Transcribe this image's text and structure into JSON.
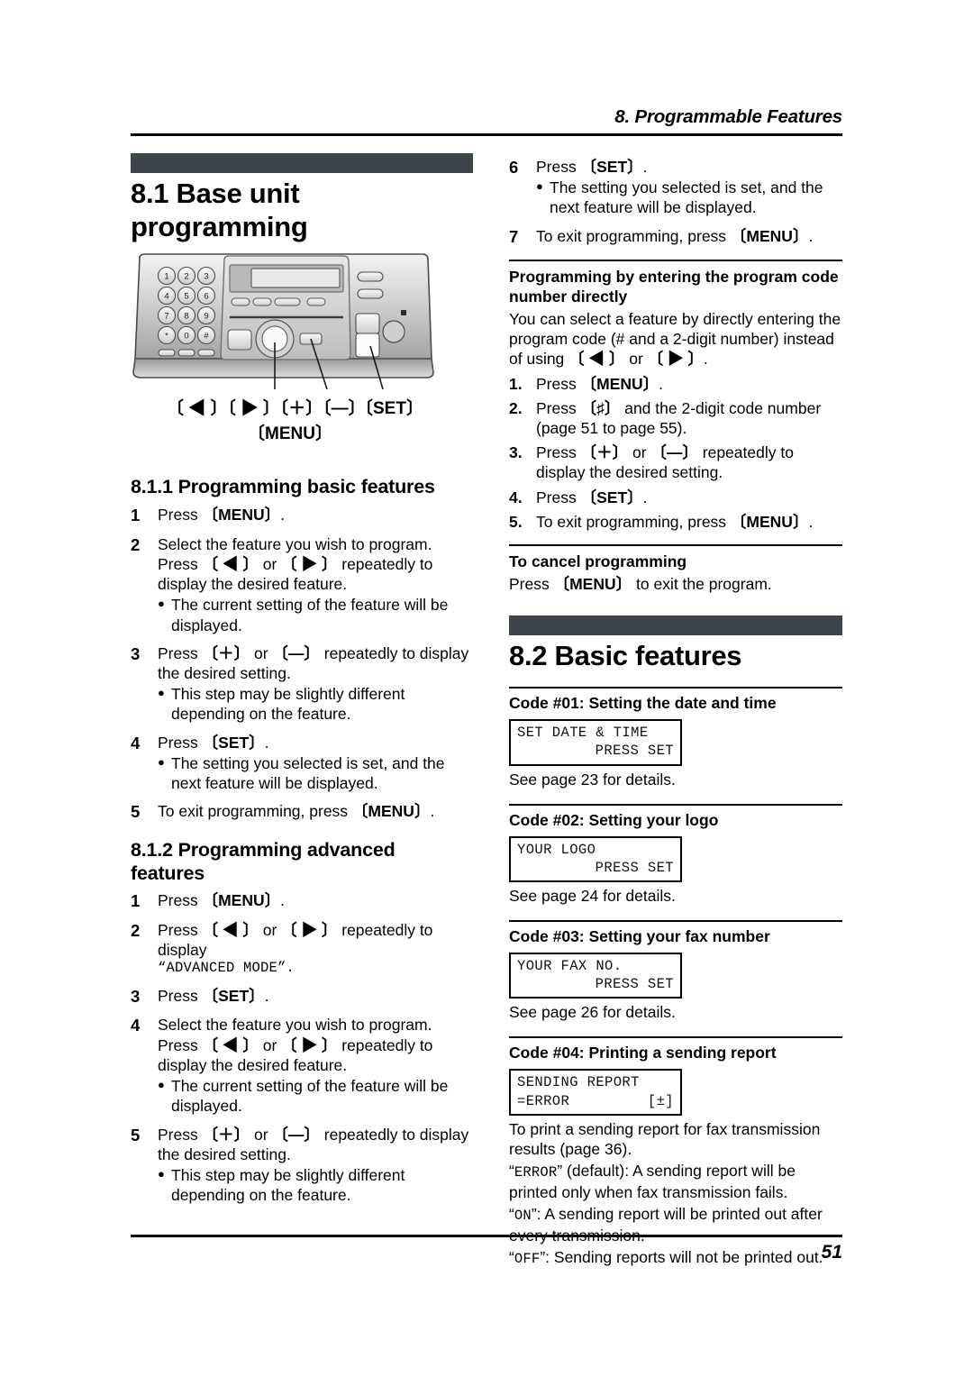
{
  "header": {
    "chapter_title": "8. Programmable Features",
    "page_number": "51"
  },
  "left_column": {
    "section": {
      "number_title": "8.1 Base unit programming"
    },
    "illustration": {
      "name": "base-unit-control-panel",
      "keypad_digits": [
        "1",
        "2",
        "3",
        "4",
        "5",
        "6",
        "7",
        "8",
        "9",
        "*",
        "0",
        "#"
      ],
      "callout_keys": "〔 ◀ 〕〔 ▶ 〕〔＋〕〔—〕",
      "callout_set": "〔SET〕",
      "callout_menu": "〔MENU〕"
    },
    "subsection_811": {
      "title": "8.1.1 Programming basic features",
      "steps": [
        {
          "n": "1",
          "lines": [
            "Press 〔MENU〕."
          ],
          "bullets": []
        },
        {
          "n": "2",
          "lines": [
            "Select the feature you wish to program.",
            "Press 〔 ◀ 〕 or 〔 ▶ 〕 repeatedly to display the desired feature."
          ],
          "bullets": [
            "The current setting of the feature will be displayed."
          ]
        },
        {
          "n": "3",
          "lines": [
            "Press 〔＋〕 or 〔—〕 repeatedly to display the desired setting."
          ],
          "bullets": [
            "This step may be slightly different depending on the feature."
          ]
        },
        {
          "n": "4",
          "lines": [
            "Press 〔SET〕."
          ],
          "bullets": [
            "The setting you selected is set, and the next feature will be displayed."
          ]
        },
        {
          "n": "5",
          "lines": [
            "To exit programming, press 〔MENU〕."
          ],
          "bullets": []
        }
      ]
    },
    "subsection_812": {
      "title": "8.1.2 Programming advanced features",
      "steps": [
        {
          "n": "1",
          "lines": [
            "Press 〔MENU〕."
          ],
          "bullets": []
        },
        {
          "n": "2",
          "lines": [
            "Press 〔 ◀ 〕 or 〔 ▶ 〕 repeatedly to display"
          ],
          "mono_line": "“ADVANCED MODE”.",
          "bullets": []
        },
        {
          "n": "3",
          "lines": [
            "Press 〔SET〕."
          ],
          "bullets": []
        },
        {
          "n": "4",
          "lines": [
            "Select the feature you wish to program.",
            "Press 〔 ◀ 〕 or 〔 ▶ 〕 repeatedly to display the desired feature."
          ],
          "bullets": [
            "The current setting of the feature will be displayed."
          ]
        },
        {
          "n": "5",
          "lines": [
            "Press 〔＋〕 or 〔—〕 repeatedly to display the desired setting."
          ],
          "bullets": [
            "This step may be slightly different depending on the feature."
          ]
        }
      ]
    }
  },
  "right_column": {
    "continued_steps": [
      {
        "n": "6",
        "lines": [
          "Press 〔SET〕."
        ],
        "bullets": [
          "The setting you selected is set, and the next feature will be displayed."
        ]
      },
      {
        "n": "7",
        "lines": [
          "To exit programming, press 〔MENU〕."
        ],
        "bullets": []
      }
    ],
    "direct_code": {
      "title": "Programming by entering the program code number directly",
      "intro": "You can select a feature by directly entering the program code (# and a 2-digit number) instead of using 〔 ◀ 〕 or 〔 ▶ 〕.",
      "steps": [
        {
          "n": "1.",
          "text": "Press 〔MENU〕."
        },
        {
          "n": "2.",
          "text": "Press 〔♯〕 and the 2-digit code number (page 51 to page 55)."
        },
        {
          "n": "3.",
          "text": "Press 〔＋〕 or 〔—〕 repeatedly to display the desired setting."
        },
        {
          "n": "4.",
          "text": "Press 〔SET〕."
        },
        {
          "n": "5.",
          "text": "To exit programming, press 〔MENU〕."
        }
      ]
    },
    "cancel": {
      "title": "To cancel programming",
      "text": "Press 〔MENU〕 to exit the program."
    },
    "section_82": {
      "number_title": "8.2 Basic features",
      "features": [
        {
          "heading": "Code #01: Setting the date and time",
          "lcd_line1": "SET DATE & TIME",
          "lcd_line2_right": "PRESS SET",
          "body": [
            "See page 23 for details."
          ]
        },
        {
          "heading": "Code #02: Setting your logo",
          "lcd_line1": "YOUR LOGO",
          "lcd_line2_right": "PRESS SET",
          "body": [
            "See page 24 for details."
          ]
        },
        {
          "heading": "Code #03: Setting your fax number",
          "lcd_line1": "YOUR FAX NO.",
          "lcd_line2_right": "PRESS SET",
          "body": [
            "See page 26 for details."
          ]
        },
        {
          "heading": "Code #04: Printing a sending report",
          "lcd_line1": "SENDING REPORT",
          "lcd_line2_left": "=ERROR",
          "lcd_line2_right": "[±]",
          "body": [
            "To print a sending report for fax transmission results (page 36).",
            "“ERROR” (default): A sending report will be printed only when fax transmission fails.",
            "“ON”: A sending report will be printed out after every transmission.",
            "“OFF”: Sending reports will not be printed out."
          ]
        }
      ]
    }
  },
  "colors": {
    "section_bar": "#3b454a",
    "rule": "#000000",
    "page_bg": "#ffffff"
  }
}
